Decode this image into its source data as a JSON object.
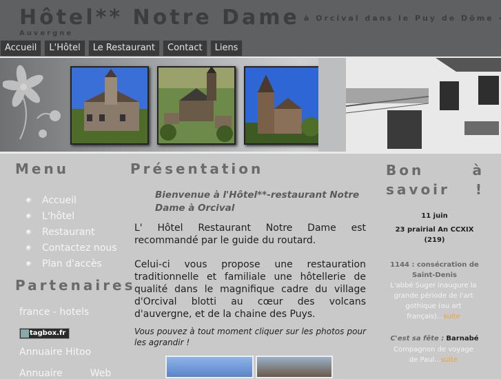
{
  "header": {
    "title": "Hôtel** Notre Dame",
    "subtitle": "à Orcival dans le Puy de Dôme -",
    "subtitle2": "Auvergne"
  },
  "nav": {
    "tabs": [
      {
        "label": "Accueil"
      },
      {
        "label": "L'Hôtel"
      },
      {
        "label": "Le Restaurant"
      },
      {
        "label": "Contact"
      },
      {
        "label": "Liens"
      }
    ]
  },
  "menu": {
    "title": "Menu",
    "items": [
      {
        "label": "Accueil"
      },
      {
        "label": "L'hôtel"
      },
      {
        "label": "Restaurant"
      },
      {
        "label": "Contactez nous"
      },
      {
        "label": "Plan d'accès"
      }
    ]
  },
  "partners": {
    "title": "Partenaires",
    "links": [
      {
        "label": "france - hotels"
      },
      {
        "label": "tagbox.fr"
      },
      {
        "label": "Annuaire Hitoo"
      },
      {
        "label": "Annuaire         Web"
      }
    ]
  },
  "presentation": {
    "title": "Présentation",
    "welcome": "Bienvenue à l'Hôtel**-restaurant Notre Dame à Orcival",
    "para1": "L' Hôtel Restaurant Notre Dame est recommandé par le guide du routard.",
    "para2": "Celui-ci vous propose une restauration traditionnelle et familiale une hôtellerie de qualité dans le magnifique cadre du village d'Orcival blotti au cœur des volcans d'auvergne, et de la chaine des Puys.",
    "click_note": "Vous pouvez à tout moment cliquer sur les photos pour les agrandir !"
  },
  "savoir": {
    "title": "Bon à savoir !",
    "date": "11 juin",
    "rep_date": "23 prairial An CCXIX",
    "rep_num": "(219)",
    "event_head": "1144 : consécration de Saint-Denis",
    "event_text": "L'abbé Suger inaugure la grande période de l'art gothique (ou art français)...",
    "fete_label": "C'est sa fête :",
    "fete_name": "Barnabé",
    "fete_text": "Compagnon de voyage de Paul...",
    "suite": "suite"
  },
  "colors": {
    "header_bg": "#5f6062",
    "tab_bg": "#3a3a3a",
    "page_bg": "#c9c9c9",
    "accent_link": "#f0a030"
  }
}
